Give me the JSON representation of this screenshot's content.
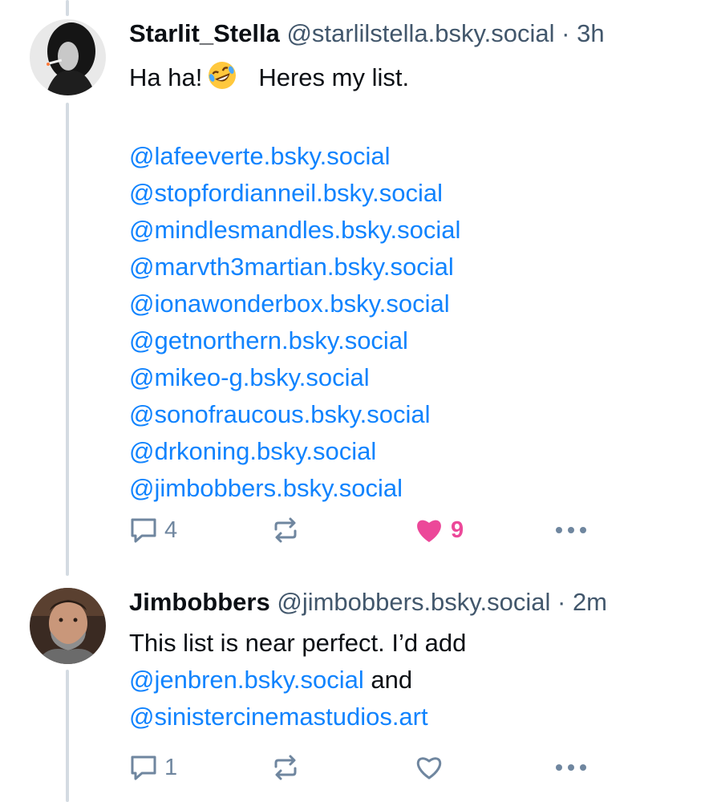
{
  "posts": [
    {
      "display_name": "Starlit_Stella",
      "handle": "@starlilstella.bsky.social",
      "separator": "·",
      "time": "3h",
      "text_prefix": "Ha ha!",
      "emoji": "rolling-on-floor-laughing-emoji",
      "text_suffix": "Heres my list.",
      "mentions": [
        "@lafeeverte.bsky.social",
        "@stopfordianneil.bsky.social",
        "@mindlesmandles.bsky.social",
        "@marvth3martian.bsky.social",
        "@ionawonderbox.bsky.social",
        "@getnorthern.bsky.social",
        "@mikeo-g.bsky.social",
        "@sonofraucous.bsky.social",
        "@drkoning.bsky.social",
        "@jimbobbers.bsky.social"
      ],
      "reply_count": "4",
      "like_count": "9",
      "liked": true
    },
    {
      "display_name": "Jimbobbers",
      "handle": "@jimbobbers.bsky.social",
      "separator": "·",
      "time": "2m",
      "text_line1": "This list is near perfect. I’d add",
      "mention1": "@jenbren.bsky.social",
      "connector": " and",
      "mention2": "@sinistercinemastudios.art",
      "reply_count": "1",
      "liked": false
    }
  ],
  "colors": {
    "link": "#1083fe",
    "handle": "#42576c",
    "icon": "#6f869f",
    "like": "#ec4899",
    "thread_line": "#d4dbe2"
  },
  "icons": [
    "reply-icon",
    "repost-icon",
    "like-icon",
    "more-icon"
  ]
}
